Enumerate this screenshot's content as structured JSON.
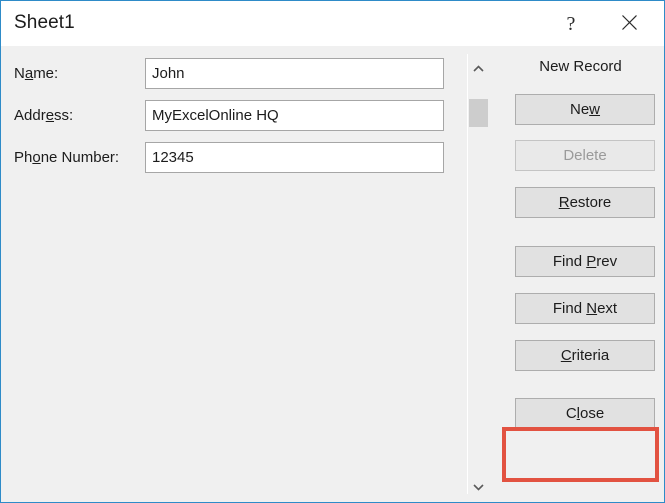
{
  "window": {
    "title": "Sheet1",
    "border_color": "#2e8bc8"
  },
  "titlebar": {
    "help_label": "?",
    "close_label": "✕"
  },
  "form": {
    "fields": [
      {
        "label_pre": "N",
        "label_accel": "a",
        "label_post": "me:",
        "value": "John",
        "name": "name"
      },
      {
        "label_pre": "Addr",
        "label_accel": "e",
        "label_post": "ss:",
        "value": "MyExcelOnline HQ",
        "name": "address"
      },
      {
        "label_pre": "Ph",
        "label_accel": "o",
        "label_post": "ne Number:",
        "value": "12345",
        "name": "phone-number"
      }
    ]
  },
  "scrollbar": {
    "up_arrow": "scroll-up-icon",
    "down_arrow": "scroll-down-icon",
    "thumb": "scroll-thumb"
  },
  "panel": {
    "status": "New Record",
    "buttons": [
      {
        "pre": "Ne",
        "accel": "w",
        "post": "",
        "name": "new",
        "disabled": false
      },
      {
        "pre": "Delete",
        "accel": "",
        "post": "",
        "name": "delete",
        "disabled": true
      },
      {
        "pre": "",
        "accel": "R",
        "post": "estore",
        "name": "restore",
        "disabled": false
      },
      {
        "pre": "Find ",
        "accel": "P",
        "post": "rev",
        "name": "find-prev",
        "disabled": false
      },
      {
        "pre": "Find ",
        "accel": "N",
        "post": "ext",
        "name": "find-next",
        "disabled": false
      },
      {
        "pre": "",
        "accel": "C",
        "post": "riteria",
        "name": "criteria",
        "disabled": false
      },
      {
        "pre": "C",
        "accel": "l",
        "post": "ose",
        "name": "close",
        "disabled": false
      }
    ]
  },
  "annotation": {
    "highlight_color": "#e25241",
    "highlight_target": "close-button"
  }
}
